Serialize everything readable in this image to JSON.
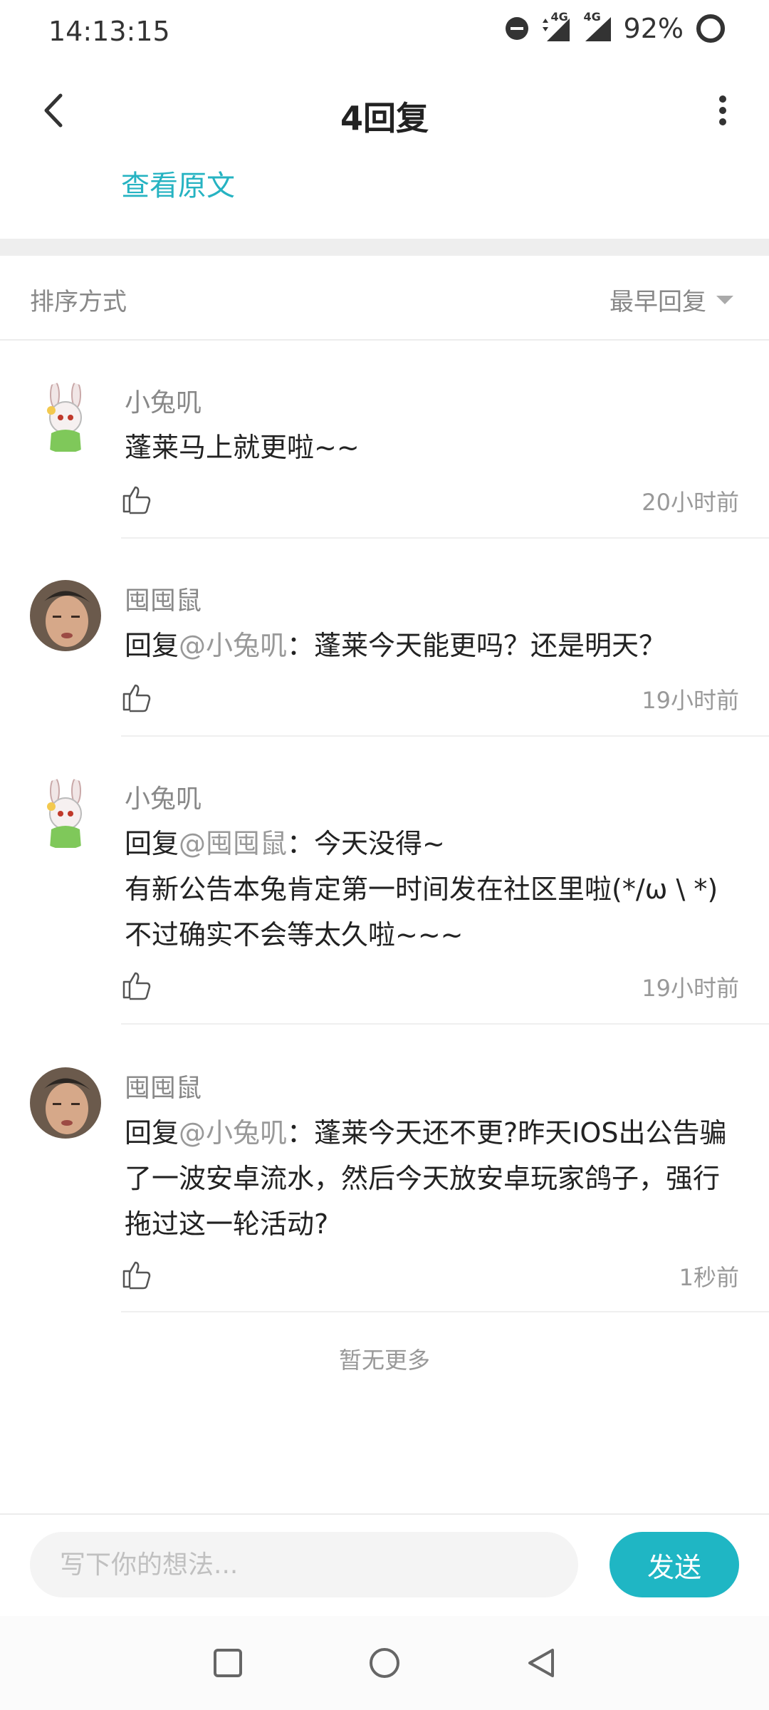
{
  "status_bar": {
    "time": "14:13:15",
    "network_1": "4G",
    "network_2": "4G",
    "battery": "92%"
  },
  "header": {
    "title": "4回复",
    "view_original": "查看原文"
  },
  "sort": {
    "label": "排序方式",
    "value": "最早回复"
  },
  "comments": [
    {
      "name": "小兔叽",
      "reply_prefix": "",
      "mention": "",
      "reply_sep": "",
      "text": "蓬莱马上就更啦~~",
      "time": "20小时前"
    },
    {
      "name": "囤囤鼠",
      "reply_prefix": "回复",
      "mention": "@小兔叽",
      "reply_sep": "：",
      "text": "蓬莱今天能更吗？还是明天？",
      "time": "19小时前"
    },
    {
      "name": "小兔叽",
      "reply_prefix": "回复",
      "mention": "@囤囤鼠",
      "reply_sep": "：",
      "text": "今天没得~\n有新公告本兔肯定第一时间发在社区里啦(*/ω \\ *)\n不过确实不会等太久啦~~~",
      "time": "19小时前"
    },
    {
      "name": "囤囤鼠",
      "reply_prefix": "回复",
      "mention": "@小兔叽",
      "reply_sep": "：",
      "text": "蓬莱今天还不更?昨天IOS出公告骗了一波安卓流水，然后今天放安卓玩家鸽子，强行拖过这一轮活动?",
      "time": "1秒前"
    }
  ],
  "footer": {
    "no_more": "暂无更多",
    "input_placeholder": "写下你的想法...",
    "send_label": "发送"
  },
  "colors": {
    "accent": "#1fb6c4",
    "link": "#26b3c2"
  }
}
